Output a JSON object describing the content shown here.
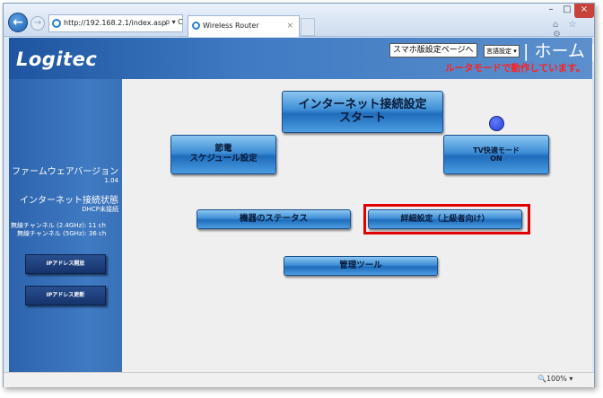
{
  "browser": {
    "address": "http://192.168.2.1/index.asp",
    "address_tools": "ρ ▾ C",
    "tab_title": "Wireless Router",
    "tab_close": "×",
    "minimize": "–",
    "maximize": "□",
    "close": "×",
    "tool_icons": "⌂ ☆ ⚙",
    "back": "←",
    "forward": "→",
    "zoom": "🔍100% ▾"
  },
  "header": {
    "logo": "Logitec",
    "smartphone_button": "スマホ版設定ページへ",
    "language_select": "言語設定 ▾",
    "home_link": "| ホーム |",
    "mode_text": "ルータモードで動作しています。"
  },
  "sidebar": {
    "firmware_label": "ファームウェアバージョン",
    "firmware_version": "1.04",
    "internet_label": "インターネット接続状態",
    "internet_value": "DHCP未接続",
    "channel_24": "無線チャンネル (2.4GHz): 11 ch",
    "channel_5": "無線チャンネル (5GHz): 36 ch",
    "ip_release": "IPアドレス開放",
    "ip_renew": "IPアドレス更新"
  },
  "main": {
    "internet_setup": "インターネット接続設定\nスタート",
    "power_schedule": "節電\nスケジュール設定",
    "tv_mode": "TV快適モード\nON",
    "device_status": "機器のステータス",
    "advanced": "詳細設定（上級者向け）",
    "admin_tools": "管理ツール"
  },
  "colors": {
    "accent_blue": "#3e8ed6",
    "sidebar_blue": "#2d63ad",
    "mode_red": "#ff2020",
    "highlight_red": "#e00000"
  }
}
